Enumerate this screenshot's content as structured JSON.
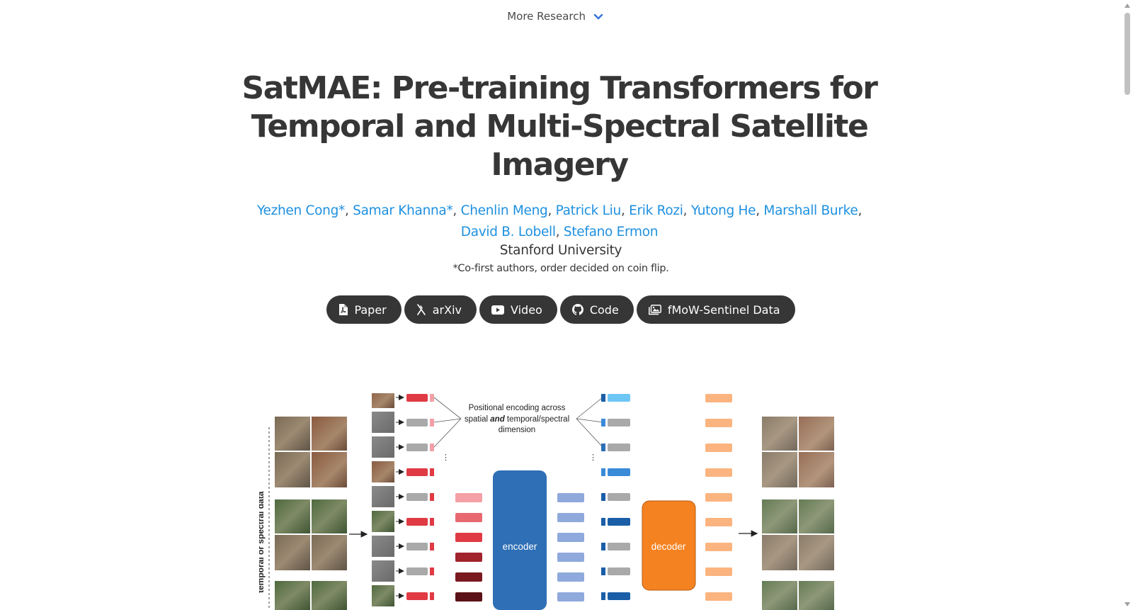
{
  "nav": {
    "more_research": "More Research"
  },
  "title": "SatMAE: Pre-training Transformers for Temporal and Multi-Spectral Satellite Imagery",
  "authors": [
    {
      "name": "Yezhen Cong*",
      "sep": ", "
    },
    {
      "name": "Samar Khanna*",
      "sep": ", "
    },
    {
      "name": "Chenlin Meng",
      "sep": ", "
    },
    {
      "name": "Patrick Liu",
      "sep": ", "
    },
    {
      "name": "Erik Rozi",
      "sep": ", "
    },
    {
      "name": "Yutong He",
      "sep": ", "
    },
    {
      "name": "Marshall Burke",
      "sep": ","
    },
    {
      "name": "David B. Lobell",
      "sep": ", "
    },
    {
      "name": "Stefano Ermon",
      "sep": ""
    }
  ],
  "affiliation": "Stanford University",
  "note": "*Co-first authors, order decided on coin flip.",
  "buttons": [
    {
      "label": "Paper",
      "icon": "file-pdf-icon"
    },
    {
      "label": "arXiv",
      "icon": "arxiv-icon"
    },
    {
      "label": "Video",
      "icon": "youtube-icon"
    },
    {
      "label": "Code",
      "icon": "github-icon"
    },
    {
      "label": "fMoW-Sentinel Data",
      "icon": "images-icon"
    }
  ],
  "figure": {
    "axis_label": "temporal or spectral data",
    "pos_encoding_line1": "Positional encoding across",
    "pos_encoding_line2a": "spatial ",
    "pos_encoding_line2b": "and",
    "pos_encoding_line2c": " temporal/spectral",
    "pos_encoding_line3": "dimension",
    "encoder_label": "encoder",
    "decoder_label": "decoder",
    "colors": {
      "encoder": "#2e6fb5",
      "decoder": "#f58220",
      "token_red": "#e03a44",
      "token_gray": "#a9a9a9",
      "token_orange": "#fbb47f",
      "token_blue": "#8fa9dc"
    }
  }
}
